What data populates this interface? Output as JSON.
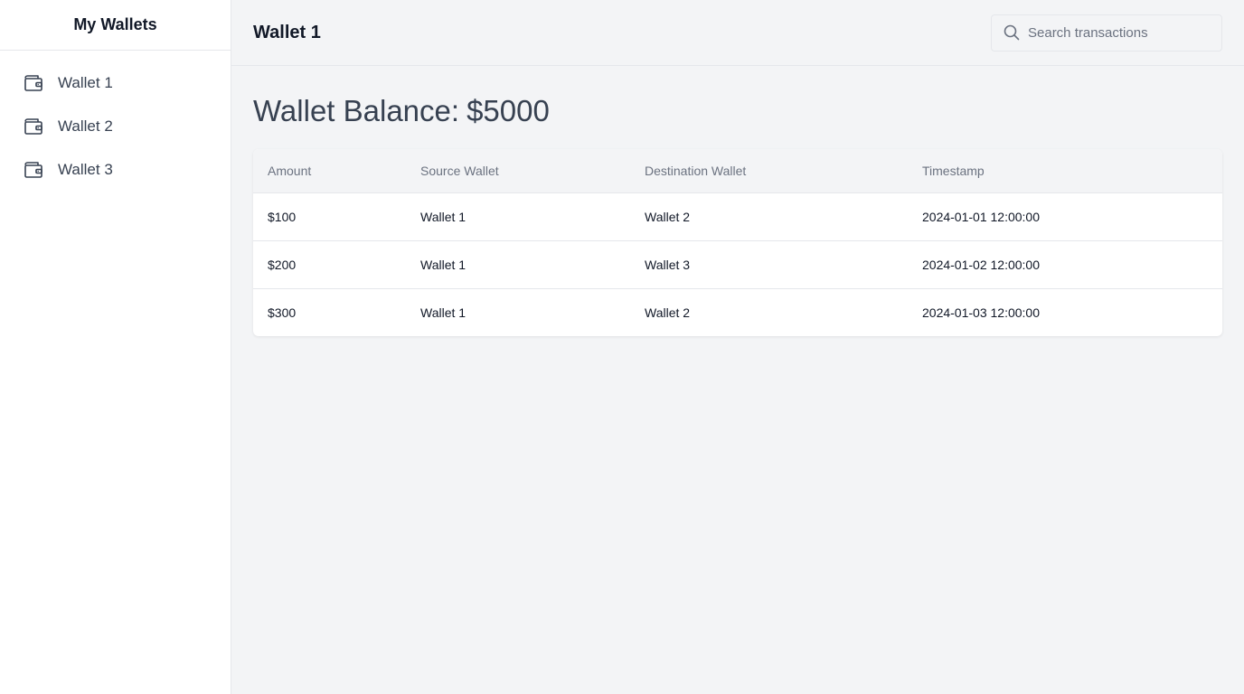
{
  "sidebar": {
    "title": "My Wallets",
    "items": [
      {
        "label": "Wallet 1",
        "icon": "wallet-icon"
      },
      {
        "label": "Wallet 2",
        "icon": "wallet-icon"
      },
      {
        "label": "Wallet 3",
        "icon": "wallet-icon"
      }
    ]
  },
  "header": {
    "title": "Wallet 1",
    "search": {
      "placeholder": "Search transactions",
      "value": "",
      "icon": "search-icon"
    }
  },
  "main": {
    "balance_label": "Wallet Balance:",
    "balance_value": "$5000",
    "table": {
      "columns": [
        "Amount",
        "Source Wallet",
        "Destination Wallet",
        "Timestamp"
      ],
      "rows": [
        [
          "$100",
          "Wallet 1",
          "Wallet 2",
          "2024-01-01 12:00:00"
        ],
        [
          "$200",
          "Wallet 1",
          "Wallet 3",
          "2024-01-02 12:00:00"
        ],
        [
          "$300",
          "Wallet 1",
          "Wallet 2",
          "2024-01-03 12:00:00"
        ]
      ]
    }
  },
  "colors": {
    "sidebar_bg": "#ffffff",
    "main_bg": "#f3f4f6",
    "border": "#e5e7eb",
    "text_primary": "#111827",
    "text_muted": "#6b7280"
  }
}
